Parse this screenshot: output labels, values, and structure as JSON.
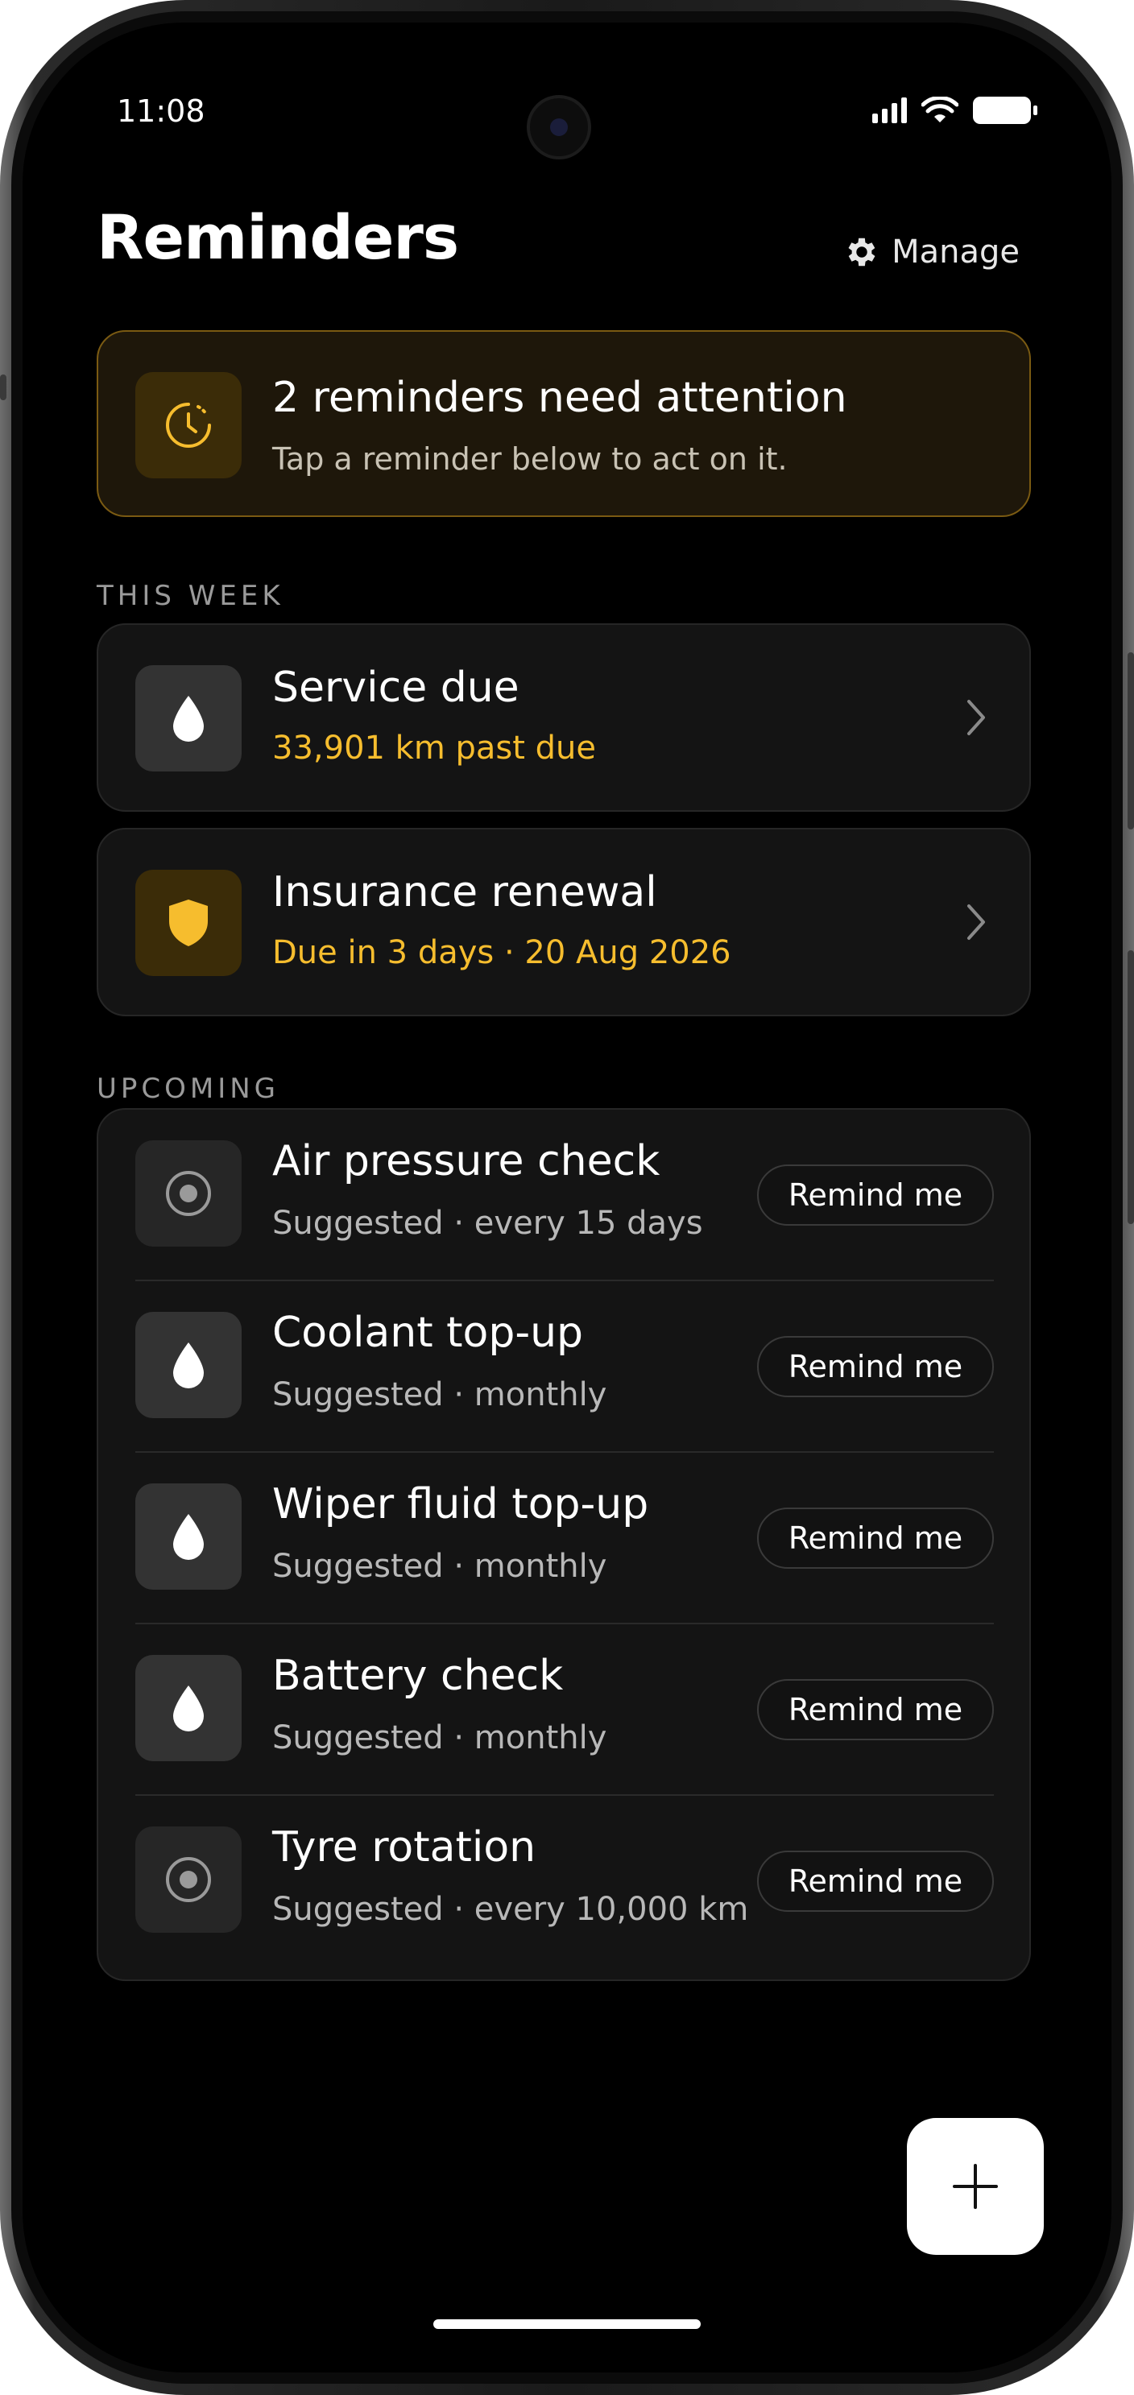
{
  "status_bar": {
    "time": "11:08"
  },
  "header": {
    "title": "Reminders",
    "manage_label": "Manage"
  },
  "banner": {
    "title": "2 reminders need attention",
    "subtitle": "Tap a reminder below to act on it."
  },
  "this_week": {
    "label": "THIS WEEK",
    "items": [
      {
        "title": "Service due",
        "subtitle": "33,901 km past due",
        "icon": "drop-icon"
      },
      {
        "title": "Insurance renewal",
        "subtitle": "Due in 3 days · 20 Aug 2026",
        "icon": "shield-icon"
      }
    ]
  },
  "upcoming": {
    "label": "UPCOMING",
    "button_label": "Remind me",
    "items": [
      {
        "title": "Air pressure check",
        "subtitle": "Suggested · every 15 days",
        "icon": "target-icon"
      },
      {
        "title": "Coolant top-up",
        "subtitle": "Suggested · monthly",
        "icon": "drop-icon"
      },
      {
        "title": "Wiper fluid top-up",
        "subtitle": "Suggested · monthly",
        "icon": "drop-icon"
      },
      {
        "title": "Battery check",
        "subtitle": "Suggested · monthly",
        "icon": "drop-icon"
      },
      {
        "title": "Tyre rotation",
        "subtitle": "Suggested · every 10,000 km",
        "icon": "target-icon"
      }
    ]
  },
  "colors": {
    "accent": "#f6bd2e",
    "background": "#000000",
    "card": "#141414",
    "banner_bg": "#1e170a",
    "banner_border": "#7a5a12"
  }
}
